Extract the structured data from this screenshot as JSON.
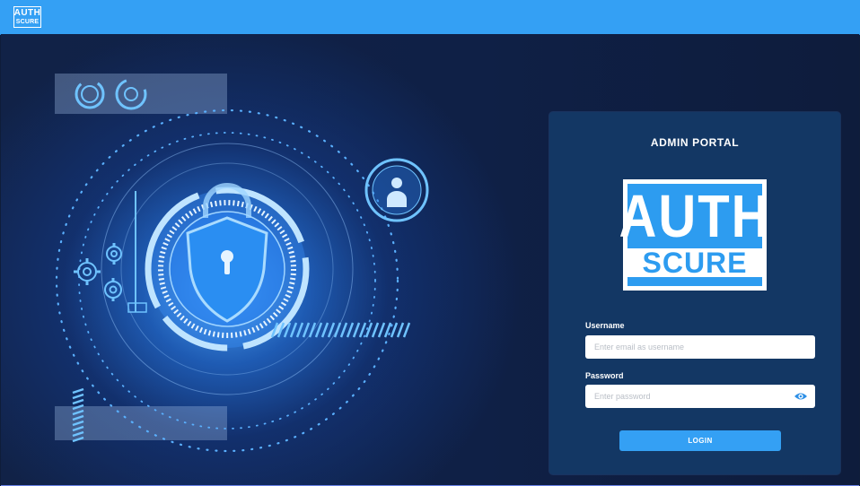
{
  "header": {
    "logo_line1": "AUTH",
    "logo_line2": "SCURE"
  },
  "hero": {
    "illustration": "security-shield-lock",
    "icons": [
      "shield-lock-icon",
      "user-badge-icon",
      "gear-icon"
    ]
  },
  "login": {
    "title": "ADMIN PORTAL",
    "logo_line1": "AUTH",
    "logo_line2": "SCURE",
    "username_label": "Username",
    "username_placeholder": "Enter email as username",
    "username_value": "",
    "password_label": "Password",
    "password_placeholder": "Enter password",
    "password_value": "",
    "show_password_icon": "eye-icon",
    "login_button": "LOGIN"
  },
  "colors": {
    "topbar": "#34a0f4",
    "panel": "#133764",
    "accent": "#34a0f4",
    "background": "#0f1d3a"
  }
}
